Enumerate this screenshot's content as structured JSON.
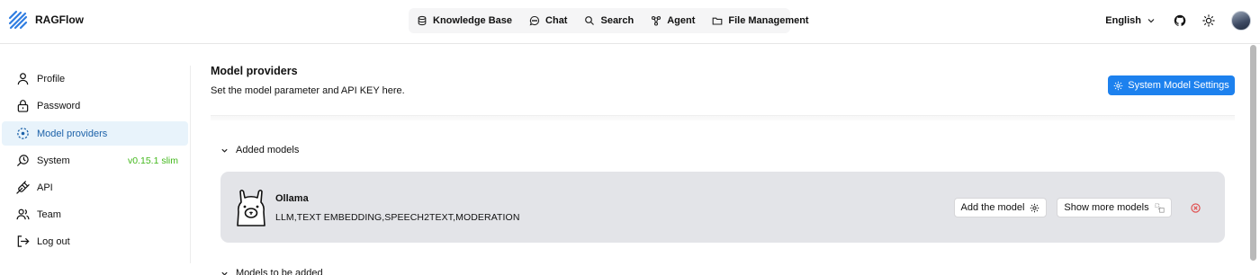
{
  "app": {
    "title": "RAGFlow"
  },
  "nav": {
    "items": [
      {
        "label": "Knowledge Base",
        "icon": "database-icon"
      },
      {
        "label": "Chat",
        "icon": "chat-icon"
      },
      {
        "label": "Search",
        "icon": "search-icon"
      },
      {
        "label": "Agent",
        "icon": "agent-icon"
      },
      {
        "label": "File Management",
        "icon": "folder-icon"
      }
    ]
  },
  "header": {
    "language": "English",
    "icons": [
      "github-icon",
      "theme-sun-icon"
    ]
  },
  "sidebar": {
    "items": [
      {
        "label": "Profile",
        "icon": "user-icon"
      },
      {
        "label": "Password",
        "icon": "lock-icon"
      },
      {
        "label": "Model providers",
        "icon": "model-providers-icon",
        "active": true
      },
      {
        "label": "System",
        "icon": "system-icon",
        "version": "v0.15.1 slim"
      },
      {
        "label": "API",
        "icon": "api-plug-icon"
      },
      {
        "label": "Team",
        "icon": "team-icon"
      },
      {
        "label": "Log out",
        "icon": "logout-icon"
      }
    ]
  },
  "main": {
    "title": "Model providers",
    "subtitle": "Set the model parameter and API KEY here.",
    "system_settings_label": "System Model Settings",
    "added_models_label": "Added models",
    "to_be_added_label": "Models to be added",
    "providers": [
      {
        "name": "Ollama",
        "tags": "LLM,TEXT EMBEDDING,SPEECH2TEXT,MODERATION",
        "add_label": "Add the model",
        "more_label": "Show more models"
      }
    ]
  },
  "colors": {
    "accent": "#1d81ee",
    "active_bg": "#e8f3fb",
    "active_text": "#1d62a9",
    "version": "#43b81c",
    "danger": "#e04545"
  }
}
